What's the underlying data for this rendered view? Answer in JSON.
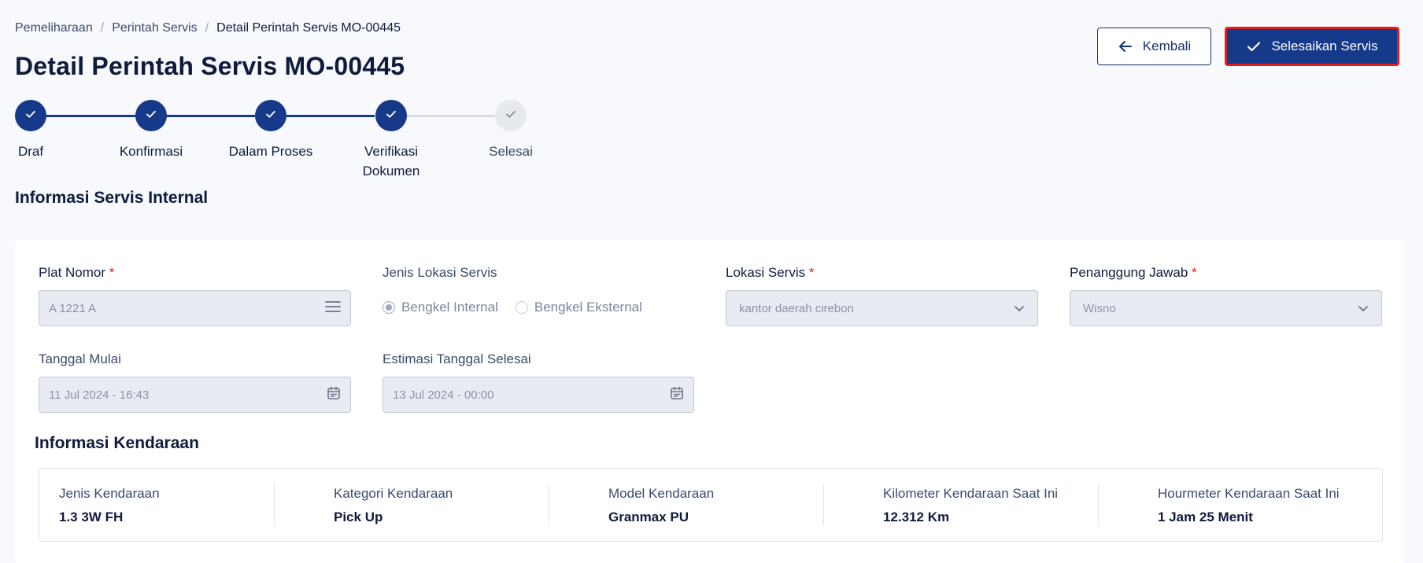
{
  "breadcrumb": {
    "items": [
      "Pemeliharaan",
      "Perintah Servis",
      "Detail Perintah Servis MO-00445"
    ],
    "separator": "/"
  },
  "page_title": "Detail Perintah Servis MO-00445",
  "actions": {
    "back_label": "Kembali",
    "finish_label": "Selesaikan Servis"
  },
  "stepper": {
    "steps": [
      {
        "label": "Draf",
        "done": true
      },
      {
        "label": "Konfirmasi",
        "done": true
      },
      {
        "label": "Dalam Proses",
        "done": true
      },
      {
        "label": "Verifikasi Dokumen",
        "done": true
      },
      {
        "label": "Selesai",
        "done": false
      }
    ]
  },
  "section_title": "Informasi Servis Internal",
  "form": {
    "plate": {
      "label": "Plat Nomor",
      "required_mark": "*",
      "value": "A 1221 A"
    },
    "location_type": {
      "label": "Jenis Lokasi Servis",
      "options": [
        "Bengkel Internal",
        "Bengkel Eksternal"
      ],
      "selected": "Bengkel Internal"
    },
    "location": {
      "label": "Lokasi Servis",
      "required_mark": "*",
      "value": "kantor daerah cirebon"
    },
    "pic": {
      "label": "Penanggung Jawab",
      "required_mark": "*",
      "value": "Wisno"
    },
    "start_date": {
      "label": "Tanggal Mulai",
      "value": "11 Jul 2024 - 16:43"
    },
    "end_date": {
      "label": "Estimasi Tanggal Selesai",
      "value": "13 Jul 2024 - 00:00"
    }
  },
  "vehicle": {
    "title": "Informasi Kendaraan",
    "items": [
      {
        "label": "Jenis Kendaraan",
        "value": "1.3 3W FH"
      },
      {
        "label": "Kategori Kendaraan",
        "value": "Pick Up"
      },
      {
        "label": "Model Kendaraan",
        "value": "Granmax PU"
      },
      {
        "label": "Kilometer Kendaraan Saat Ini",
        "value": "12.312 Km"
      },
      {
        "label": "Hourmeter Kendaraan Saat Ini",
        "value": "1 Jam 25 Menit"
      }
    ]
  },
  "colors": {
    "primary": "#16398a",
    "highlight_border": "#e11d1d",
    "required": "#e11d1d"
  }
}
